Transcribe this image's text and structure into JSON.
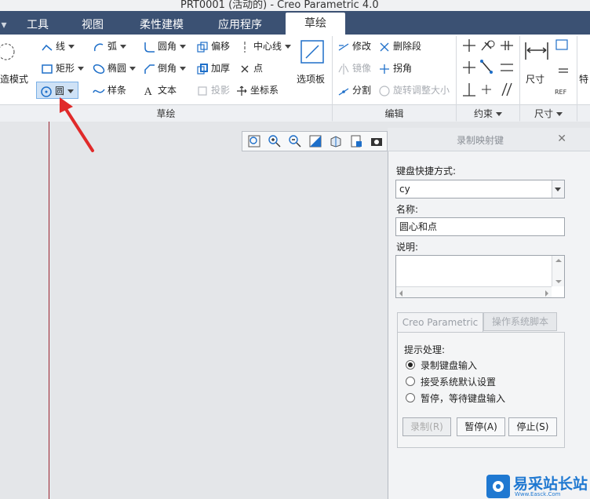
{
  "window": {
    "title": "PRT0001 (活动的) - Creo Parametric 4.0"
  },
  "tabs": [
    {
      "label": "工具"
    },
    {
      "label": "视图"
    },
    {
      "label": "柔性建模"
    },
    {
      "label": "应用程序"
    },
    {
      "label": "草绘"
    }
  ],
  "ribbon": {
    "setup_label": "造模式",
    "sketch_group": {
      "label": "草绘",
      "line": "线",
      "arc": "弧",
      "fillet": "圆角",
      "offset": "偏移",
      "centerline": "中心线",
      "rectangle": "矩形",
      "ellipse": "椭圆",
      "chamfer": "倒角",
      "thicken": "加厚",
      "point": "点",
      "circle": "圆",
      "spline": "样条",
      "text": "文本",
      "project": "投影",
      "coordsys": "坐标系",
      "palette": "选项板"
    },
    "edit_group": {
      "label": "编辑",
      "modify": "修改",
      "delete_segment": "删除段",
      "mirror": "镜像",
      "corner": "拐角",
      "divide": "分割",
      "rotate_resize": "旋转调整大小"
    },
    "constrain_group": {
      "label": "约束"
    },
    "dimension_group": {
      "label": "尺寸",
      "dimension": "尺寸",
      "ref_text": "REF"
    },
    "extra_label": "特"
  },
  "dialog": {
    "title": "录制映射键",
    "shortcut_label": "键盘快捷方式:",
    "shortcut_value": "cy",
    "name_label": "名称:",
    "name_value": "圆心和点",
    "desc_label": "说明:",
    "desc_value": "",
    "subtabs": [
      {
        "label": "Creo Parametric"
      },
      {
        "label": "操作系统脚本"
      }
    ],
    "prompt_label": "提示处理:",
    "options": [
      {
        "label": "录制键盘输入",
        "selected": true
      },
      {
        "label": "接受系统默认设置",
        "selected": false
      },
      {
        "label": "暂停，等待键盘输入",
        "selected": false
      }
    ],
    "buttons": {
      "record": "录制(R)",
      "pause": "暂停(A)",
      "stop": "停止(S)"
    }
  },
  "watermark": {
    "text": "易采站长站",
    "sub": "Www.Easck.Com"
  },
  "colors": {
    "tabbar": "#3b5173",
    "accent": "#1e6fc9",
    "arrow": "#e02a2a",
    "redline": "#9b2430"
  }
}
